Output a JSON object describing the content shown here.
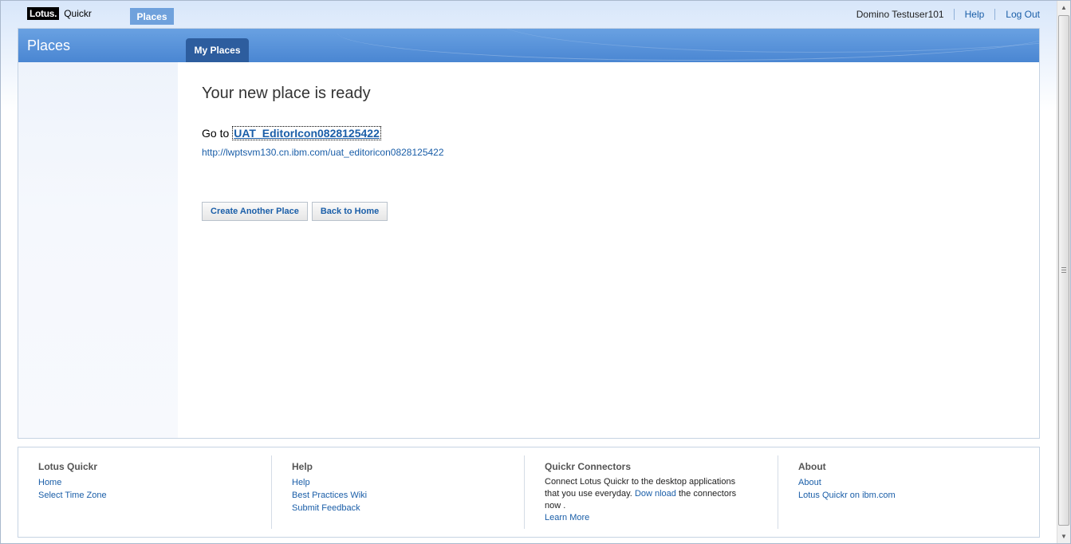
{
  "banner": {
    "logo_box": "Lotus.",
    "logo_text": "Quickr",
    "nav_tab": "Places",
    "user": "Domino Testuser101",
    "help": "Help",
    "logout": "Log Out"
  },
  "main": {
    "title": "Places",
    "tab": "My Places",
    "heading": "Your new place is ready",
    "goto_label": "Go to",
    "place_link": "UAT_EditorIcon0828125422",
    "place_url": "http://lwptsvm130.cn.ibm.com/uat_editoricon0828125422",
    "buttons": {
      "create_another": "Create Another Place",
      "back_home": "Back to Home"
    }
  },
  "footer": {
    "col1": {
      "title": "Lotus Quickr",
      "links": [
        "Home",
        "Select Time Zone"
      ]
    },
    "col2": {
      "title": "Help",
      "links": [
        "Help",
        "Best Practices Wiki",
        "Submit Feedback"
      ]
    },
    "col3": {
      "title": "Quickr Connectors",
      "text_before": "Connect Lotus Quickr to the desktop applications that you use everyday.",
      "download": "Dow nload",
      "text_after": "the connectors now .",
      "learn_more": "Learn More"
    },
    "col4": {
      "title": "About",
      "links": [
        "About",
        "Lotus Quickr on ibm.com"
      ]
    }
  },
  "colors": {
    "title_bar": "#4a86d2",
    "tab_active": "#2d5d9e",
    "link": "#1a5ea8",
    "nav_tab": "#6fa1dc"
  }
}
